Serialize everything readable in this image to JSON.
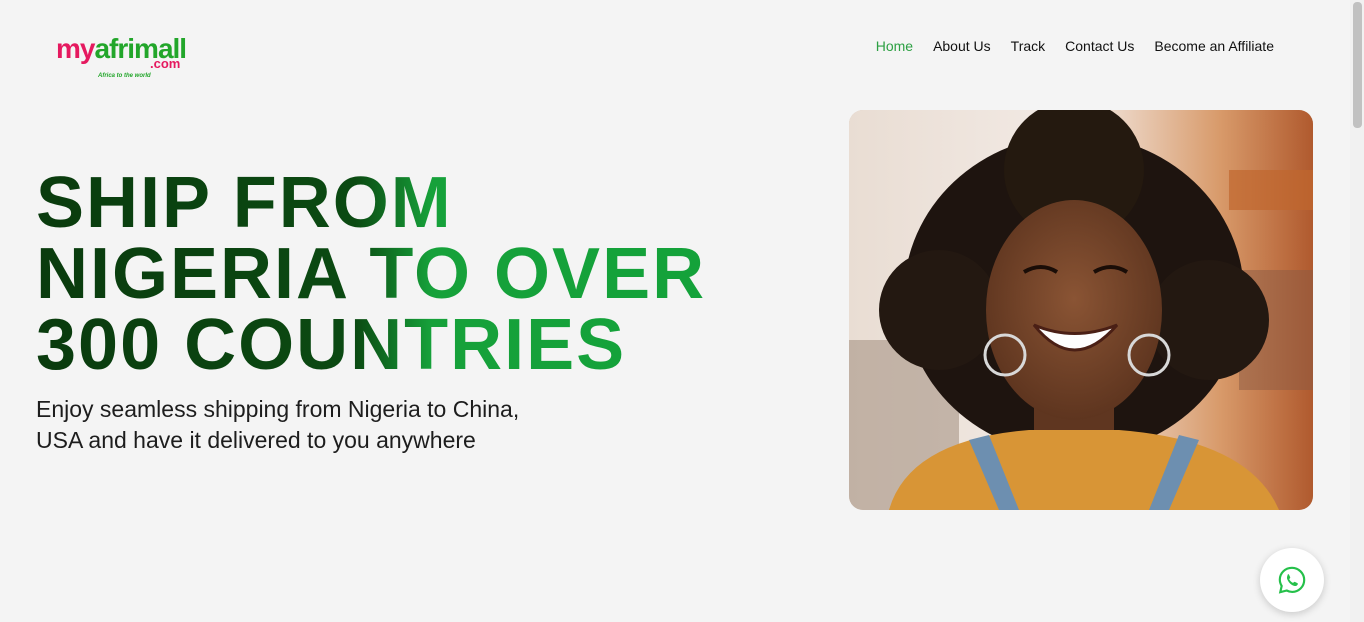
{
  "header": {
    "logo": {
      "my": "my",
      "afrimall": "afrimall",
      "dotcom": ".com",
      "tagline": "Africa to the world"
    },
    "nav": [
      {
        "label": "Home",
        "active": true
      },
      {
        "label": "About Us",
        "active": false
      },
      {
        "label": "Track",
        "active": false
      },
      {
        "label": "Contact Us",
        "active": false
      },
      {
        "label": "Become an Affiliate",
        "active": false
      }
    ]
  },
  "hero": {
    "title_lines": [
      "SHIP FROM",
      "NIGERIA TO OVER",
      "300 COUNTRIES"
    ],
    "subtitle_lines": [
      "Enjoy seamless shipping from Nigeria to China,",
      "USA and have it delivered to you anywhere"
    ],
    "image_icon": "smiling-woman-photo"
  },
  "whatsapp": {
    "icon": "whatsapp-icon"
  },
  "colors": {
    "accent_green": "#2da043",
    "title_dark_green": "#0a3b0e",
    "title_bright_green": "#16a13a",
    "logo_pink": "#e5195f",
    "logo_green": "#22a62a",
    "background": "#f4f4f4"
  }
}
